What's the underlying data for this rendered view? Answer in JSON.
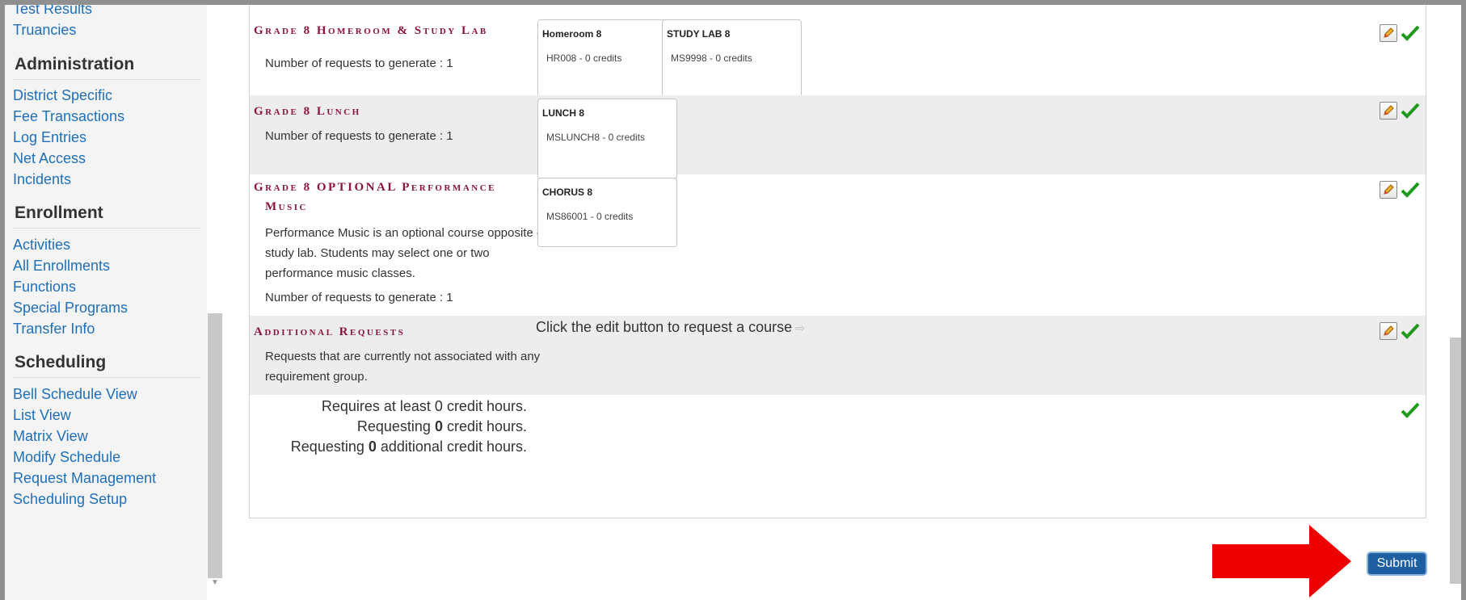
{
  "sidebar": {
    "top_links": [
      "Test Results",
      "Truancies"
    ],
    "sections": [
      {
        "heading": "Administration",
        "links": [
          "District Specific",
          "Fee Transactions",
          "Log Entries",
          "Net Access",
          "Incidents"
        ]
      },
      {
        "heading": "Enrollment",
        "links": [
          "Activities",
          "All Enrollments",
          "Functions",
          "Special Programs",
          "Transfer Info"
        ]
      },
      {
        "heading": "Scheduling",
        "links": [
          "Bell Schedule View",
          "List View",
          "Matrix View",
          "Modify Schedule",
          "Request Management",
          "Scheduling Setup"
        ]
      }
    ]
  },
  "requirements": [
    {
      "title": "Grade 8 Homeroom & Study Lab",
      "requests_text": "Number of requests to generate : 1",
      "courses": [
        {
          "name": "Homeroom 8",
          "code": "HR008 - 0 credits"
        },
        {
          "name": "STUDY LAB 8",
          "code": "MS9998 - 0 credits"
        }
      ]
    },
    {
      "title": "Grade 8 Lunch",
      "requests_text": "Number of requests to generate : 1",
      "courses": [
        {
          "name": "LUNCH 8",
          "code": "MSLUNCH8 - 0 credits"
        }
      ]
    },
    {
      "title_line1": "Grade 8 OPTIONAL Performance",
      "title_line2": "Music",
      "description": [
        "Performance Music is an optional course opposite of",
        "study lab. Students may select one or two",
        "performance music classes."
      ],
      "requests_text": "Number of requests to generate : 1",
      "courses": [
        {
          "name": "CHORUS 8",
          "code": "MS86001 - 0 credits"
        }
      ]
    },
    {
      "title": "Additional Requests",
      "description": [
        "Requests that are currently not associated with any",
        "requirement group."
      ],
      "hint": "Click the edit button to request a course",
      "hint_arrow": "⇨"
    }
  ],
  "summary": {
    "line1": "Requires at least 0 credit hours.",
    "line2_prefix": "Requesting ",
    "line2_value": "0",
    "line2_suffix": " credit hours.",
    "line3_prefix": "Requesting ",
    "line3_value": "0",
    "line3_suffix": " additional credit hours."
  },
  "submit_label": "Submit",
  "colors": {
    "title": "#8b1538",
    "link": "#1f6fb8",
    "submit": "#1d5fa0",
    "check": "#1f9a1f",
    "arrow": "#ee0000"
  }
}
